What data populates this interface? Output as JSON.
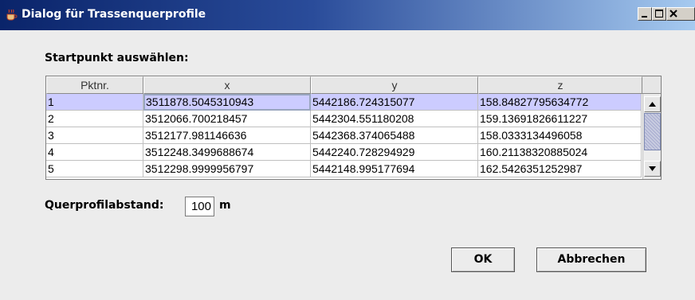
{
  "window": {
    "title": "Dialog für Trassenquerprofile",
    "controls": [
      "minimize-icon",
      "maximize-icon",
      "close-icon"
    ]
  },
  "start_label": "Startpunkt auswählen:",
  "table": {
    "columns": [
      "Pktnr.",
      "x",
      "y",
      "z"
    ],
    "rows": [
      {
        "n": "1",
        "x": "3511878.5045310943",
        "y": "5442186.724315077",
        "z": "158.84827795634772"
      },
      {
        "n": "2",
        "x": "3512066.700218457",
        "y": "5442304.551180208",
        "z": "159.13691826611227"
      },
      {
        "n": "3",
        "x": "3512177.981146636",
        "y": "5442368.374065488",
        "z": "158.0333134496058"
      },
      {
        "n": "4",
        "x": "3512248.3499688674",
        "y": "5442240.728294929",
        "z": "160.21138320885024"
      },
      {
        "n": "5",
        "x": "3512298.9999956797",
        "y": "5442148.995177694",
        "z": "162.5426351252987"
      }
    ],
    "selected_row": 1
  },
  "spacing": {
    "label": "Querprofilabstand:",
    "value": "100",
    "unit": "m"
  },
  "buttons": {
    "ok": "OK",
    "cancel": "Abbrechen"
  },
  "colors": {
    "title_gradient_start": "#0a246a",
    "selected_row": "#ccccff",
    "background": "#ececec"
  }
}
